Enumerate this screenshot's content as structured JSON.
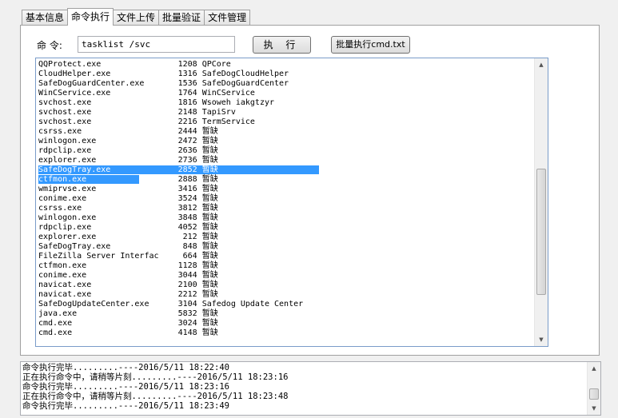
{
  "tabs": [
    {
      "label": "基本信息",
      "active": false
    },
    {
      "label": "命令执行",
      "active": true
    },
    {
      "label": "文件上传",
      "active": false
    },
    {
      "label": "批量验证",
      "active": false
    },
    {
      "label": "文件管理",
      "active": false
    }
  ],
  "command": {
    "label": "命 令:",
    "value": "tasklist /svc",
    "execute_label": "执 行",
    "batch_label": "批量执行cmd.txt"
  },
  "output": {
    "lines": [
      {
        "text": "QQProtect.exe                1208 QPCore",
        "selected": false
      },
      {
        "text": "CloudHelper.exe              1316 SafeDogCloudHelper",
        "selected": false
      },
      {
        "text": "SafeDogGuardCenter.exe       1536 SafeDogGuardCenter",
        "selected": false
      },
      {
        "text": "WinCService.exe              1764 WinCService",
        "selected": false
      },
      {
        "text": "svchost.exe                  1816 Wsoweh iakgtzyr",
        "selected": false
      },
      {
        "text": "svchost.exe                  2148 TapiSrv",
        "selected": false
      },
      {
        "text": "svchost.exe                  2216 TermService",
        "selected": false
      },
      {
        "text": "csrss.exe                    2444 暂缺",
        "selected": false
      },
      {
        "text": "winlogon.exe                 2472 暂缺",
        "selected": false
      },
      {
        "text": "rdpclip.exe                  2636 暂缺",
        "selected": false
      },
      {
        "text": "explorer.exe                 2736 暂缺",
        "selected": false
      },
      {
        "text": "SafeDogTray.exe              2852 暂缺                     ",
        "selected": true
      },
      {
        "text": "ctfmon.exe           ",
        "selected": true,
        "rest": "        2888 暂缺"
      },
      {
        "text": "wmiprvse.exe                 3416 暂缺",
        "selected": false
      },
      {
        "text": "conime.exe                   3524 暂缺",
        "selected": false
      },
      {
        "text": "csrss.exe                    3812 暂缺",
        "selected": false
      },
      {
        "text": "winlogon.exe                 3848 暂缺",
        "selected": false
      },
      {
        "text": "rdpclip.exe                  4052 暂缺",
        "selected": false
      },
      {
        "text": "explorer.exe                  212 暂缺",
        "selected": false
      },
      {
        "text": "SafeDogTray.exe               848 暂缺",
        "selected": false
      },
      {
        "text": "FileZilla Server Interfac     664 暂缺",
        "selected": false
      },
      {
        "text": "ctfmon.exe                   1128 暂缺",
        "selected": false
      },
      {
        "text": "conime.exe                   3044 暂缺",
        "selected": false
      },
      {
        "text": "navicat.exe                  2100 暂缺",
        "selected": false
      },
      {
        "text": "navicat.exe                  2212 暂缺",
        "selected": false
      },
      {
        "text": "SafeDogUpdateCenter.exe      3104 Safedog Update Center",
        "selected": false
      },
      {
        "text": "java.exe                     5832 暂缺",
        "selected": false
      },
      {
        "text": "cmd.exe                      3024 暂缺",
        "selected": false
      },
      {
        "text": "cmd.exe                      4148 暂缺",
        "selected": false
      }
    ],
    "scroll_position": 0.72
  },
  "log": {
    "lines": [
      "命令执行完毕.........----2016/5/11 18:22:40",
      "正在执行命令中，请稍等片刻.........----2016/5/11 18:23:16",
      "命令执行完毕.........----2016/5/11 18:23:16",
      "正在执行命令中，请稍等片刻.........----2016/5/11 18:23:48",
      "命令执行完毕.........----2016/5/11 18:23:49"
    ],
    "scroll_position": 0.85
  },
  "icons": {
    "scroll_up": "scroll-up-arrow-icon",
    "scroll_down": "scroll-down-arrow-icon"
  },
  "colors": {
    "selection": "#3399ff",
    "panel_border": "#a0a0a0",
    "output_border": "#7a9cc9"
  }
}
